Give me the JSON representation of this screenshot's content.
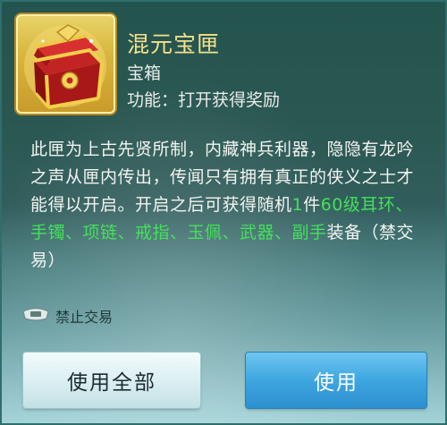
{
  "item": {
    "name": "混元宝匣",
    "type": "宝箱",
    "function_label": "功能：",
    "function_value": "打开获得奖励",
    "icon": "treasure-box-icon"
  },
  "description": {
    "part1": "此匣为上古先贤所制，内藏神兵利器，隐隐有龙吟之声从匣内传出，传闻只有拥有真正的侠义之士才能得以开启。开启之后可获得随机",
    "count": "1",
    "part2": "件",
    "highlight": "60级耳环、手镯、项链、戒指、玉佩、武器、副手",
    "part3": "装备（禁交易）"
  },
  "trade": {
    "label": "禁止交易",
    "icon": "lock-trade-icon"
  },
  "buttons": {
    "use_all": "使用全部",
    "use": "使用"
  },
  "colors": {
    "name": "#f4e08a",
    "highlight": "#44e05a",
    "use_button": "#3ea6e0"
  }
}
